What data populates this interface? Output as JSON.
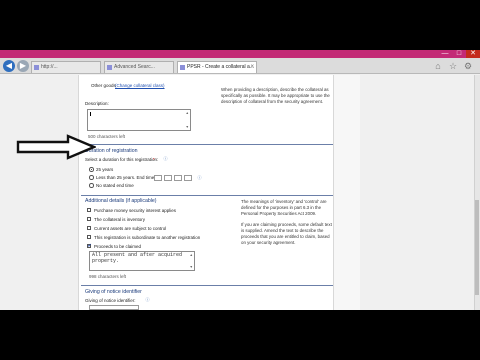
{
  "browser": {
    "tabs": [
      {
        "label": "http://..."
      },
      {
        "label": "Advanced Searc..."
      },
      {
        "label": "PPSR - Create a collateral a...",
        "active": true
      }
    ],
    "window_controls": [
      "—",
      "□",
      "✕"
    ]
  },
  "form": {
    "other_goods_label": "Other goods",
    "change_collateral_link": "(Change collateral class)",
    "description_label": "Description:",
    "description_help": "When providing a description, describe the collateral as specifically as possible. It may be appropriate to use the description of collateral from the security agreement.",
    "description_chars_left": "500 characters left",
    "duration": {
      "title": "Duration of registration",
      "prompt": "Select a duration for this registration:",
      "required_mark": "*",
      "options": [
        {
          "label": "25 years",
          "checked": true
        },
        {
          "label": "Less than 25 years. End time",
          "checked": false
        },
        {
          "label": "No stated end time",
          "checked": false
        }
      ]
    },
    "additional": {
      "title": "Additional details (if applicable)",
      "checkboxes": [
        {
          "label": "Purchase money security interest applies",
          "checked": false
        },
        {
          "label": "The collateral is inventory",
          "checked": false
        },
        {
          "label": "Current assets are subject to control",
          "checked": false
        },
        {
          "label": "This registration is subordinate to another registration",
          "checked": false
        },
        {
          "label": "Proceeds to be claimed",
          "checked": true
        }
      ],
      "help_p1": "The meanings of 'inventory' and 'control' are defined for the purposes in part 6.3 in the Personal Property Securities Act 2009.",
      "help_p2": "If you are claiming proceeds, some default text is supplied. Amend the text to describe the proceeds that you are entitled to claim, based on your security agreement.",
      "proceeds_text": "All present and after acquired property.",
      "proceeds_chars_left": "998 characters left"
    },
    "notice": {
      "title": "Giving of notice identifier",
      "field_label": "Giving of notice identifier:"
    }
  }
}
